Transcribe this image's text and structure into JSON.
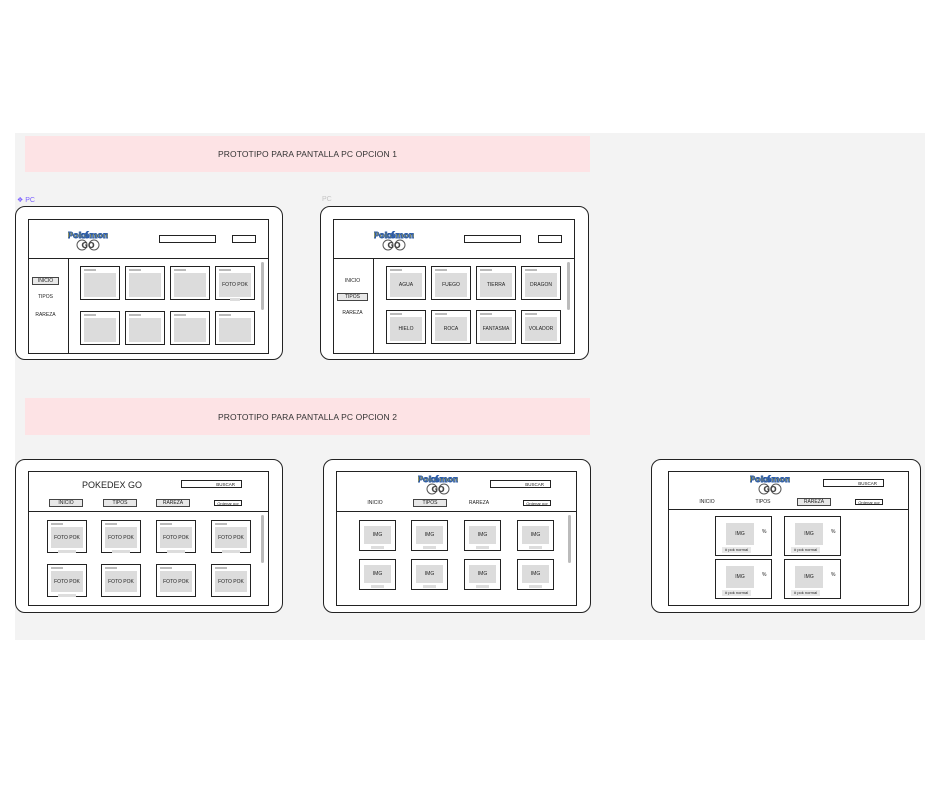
{
  "banners": {
    "option1": "PROTOTIPO PARA PANTALLA PC OPCION 1",
    "option2": "PROTOTIPO PARA PANTALLA PC OPCION 2"
  },
  "frame_labels": {
    "pc_selected": "❖ PC",
    "pc_dim": "PC"
  },
  "nav": {
    "inicio": "INICIO",
    "tipos": "TIPOS",
    "rareza": "RAREZA"
  },
  "foto_pok": "FOTO POK",
  "img": "IMG",
  "buscar": "BUSCAR",
  "ordenar": "Ordenar por",
  "pokedex_title": "POKEDEX GO",
  "types": [
    "AGUA",
    "FUEGO",
    "TIERRA",
    "DRAGON",
    "HIELO",
    "ROCA",
    "FANTASMA",
    "VOLADOR"
  ],
  "percent": "%",
  "pok_normal": "# pok normal",
  "logo_top": "Pokémon",
  "logo_bottom": "GO",
  "colors": {
    "banner": "#fde3e5",
    "board": "#f3f3f3",
    "accent": "#7b61ff"
  }
}
